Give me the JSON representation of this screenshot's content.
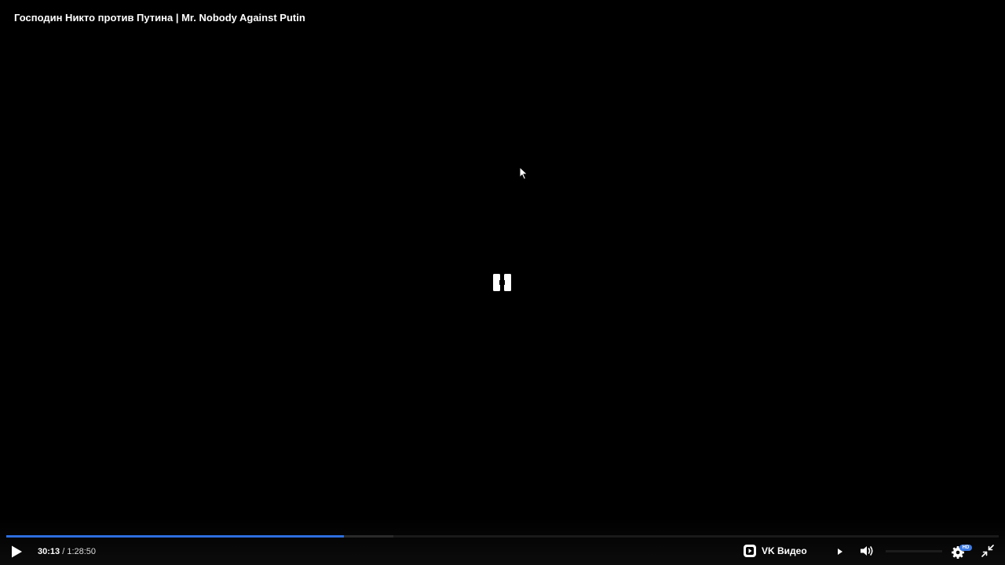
{
  "video": {
    "title": "Господин Никто против Путина | Mr. Nobody Against Putin",
    "state": "paused",
    "current_time": "30:13",
    "time_separator": "/",
    "duration": "1:28:50",
    "progress_fraction": 0.34,
    "buffered_fraction": 0.39
  },
  "controls": {
    "play_icon": "play-icon",
    "center_icon": "pause-icon",
    "brand_label": "VK Видео",
    "brand_icon": "vk-video-icon",
    "next_icon": "next-icon",
    "volume_icon": "volume-icon",
    "volume_fraction": 0.0,
    "settings_icon": "gear-icon",
    "quality_badge": "HD",
    "fullscreen_icon": "exit-fullscreen-icon"
  },
  "colors": {
    "background": "#000000",
    "accent": "#2d6fe0",
    "text": "#ffffff"
  }
}
